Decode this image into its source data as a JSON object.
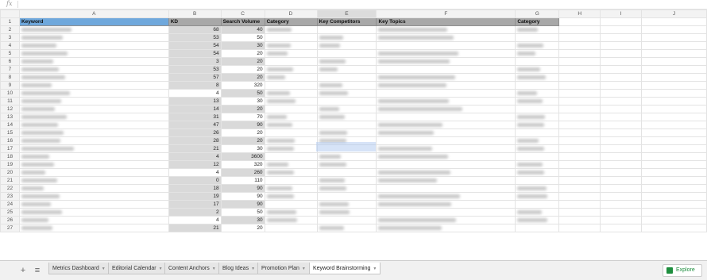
{
  "formula_bar": {
    "icon": "fx"
  },
  "columns": [
    "A",
    "B",
    "C",
    "D",
    "E",
    "F",
    "G",
    "H",
    "I",
    "J"
  ],
  "headers": [
    "Keyword",
    "KD",
    "Search Volume",
    "Category",
    "Key Competitors",
    "Key Topics",
    "Category",
    "",
    "",
    ""
  ],
  "rows": [
    {
      "n": "2",
      "kd": "68",
      "sv": "40"
    },
    {
      "n": "3",
      "kd": "53",
      "sv": "50"
    },
    {
      "n": "4",
      "kd": "54",
      "sv": "30"
    },
    {
      "n": "5",
      "kd": "54",
      "sv": "20"
    },
    {
      "n": "6",
      "kd": "3",
      "sv": "20"
    },
    {
      "n": "7",
      "kd": "53",
      "sv": "20"
    },
    {
      "n": "8",
      "kd": "57",
      "sv": "20"
    },
    {
      "n": "9",
      "kd": "8",
      "sv": "320"
    },
    {
      "n": "10",
      "kd": "4",
      "sv": "50"
    },
    {
      "n": "11",
      "kd": "13",
      "sv": "30"
    },
    {
      "n": "12",
      "kd": "14",
      "sv": "20"
    },
    {
      "n": "13",
      "kd": "31",
      "sv": "70"
    },
    {
      "n": "14",
      "kd": "47",
      "sv": "90"
    },
    {
      "n": "15",
      "kd": "26",
      "sv": "20"
    },
    {
      "n": "16",
      "kd": "28",
      "sv": "20"
    },
    {
      "n": "17",
      "kd": "21",
      "sv": "30"
    },
    {
      "n": "18",
      "kd": "4",
      "sv": "3600"
    },
    {
      "n": "19",
      "kd": "12",
      "sv": "320"
    },
    {
      "n": "20",
      "kd": "4",
      "sv": "260"
    },
    {
      "n": "21",
      "kd": "0",
      "sv": "110"
    },
    {
      "n": "22",
      "kd": "18",
      "sv": "90"
    },
    {
      "n": "23",
      "kd": "19",
      "sv": "90"
    },
    {
      "n": "24",
      "kd": "17",
      "sv": "90"
    },
    {
      "n": "25",
      "kd": "2",
      "sv": "50"
    },
    {
      "n": "26",
      "kd": "4",
      "sv": "30"
    },
    {
      "n": "27",
      "kd": "21",
      "sv": "20"
    }
  ],
  "tabs": [
    "Metrics Dashboard",
    "Editorial Calendar",
    "Content Anchors",
    "Blog Ideas",
    "Promotion Plan",
    "Keyword Brainstorming"
  ],
  "active_tab": "Keyword Brainstorming",
  "explore_label": "Explore",
  "colors": {
    "header_keyword": "#6fa8dc",
    "header_grey": "#a8a8a8",
    "accent_green": "#1e8e3e"
  }
}
